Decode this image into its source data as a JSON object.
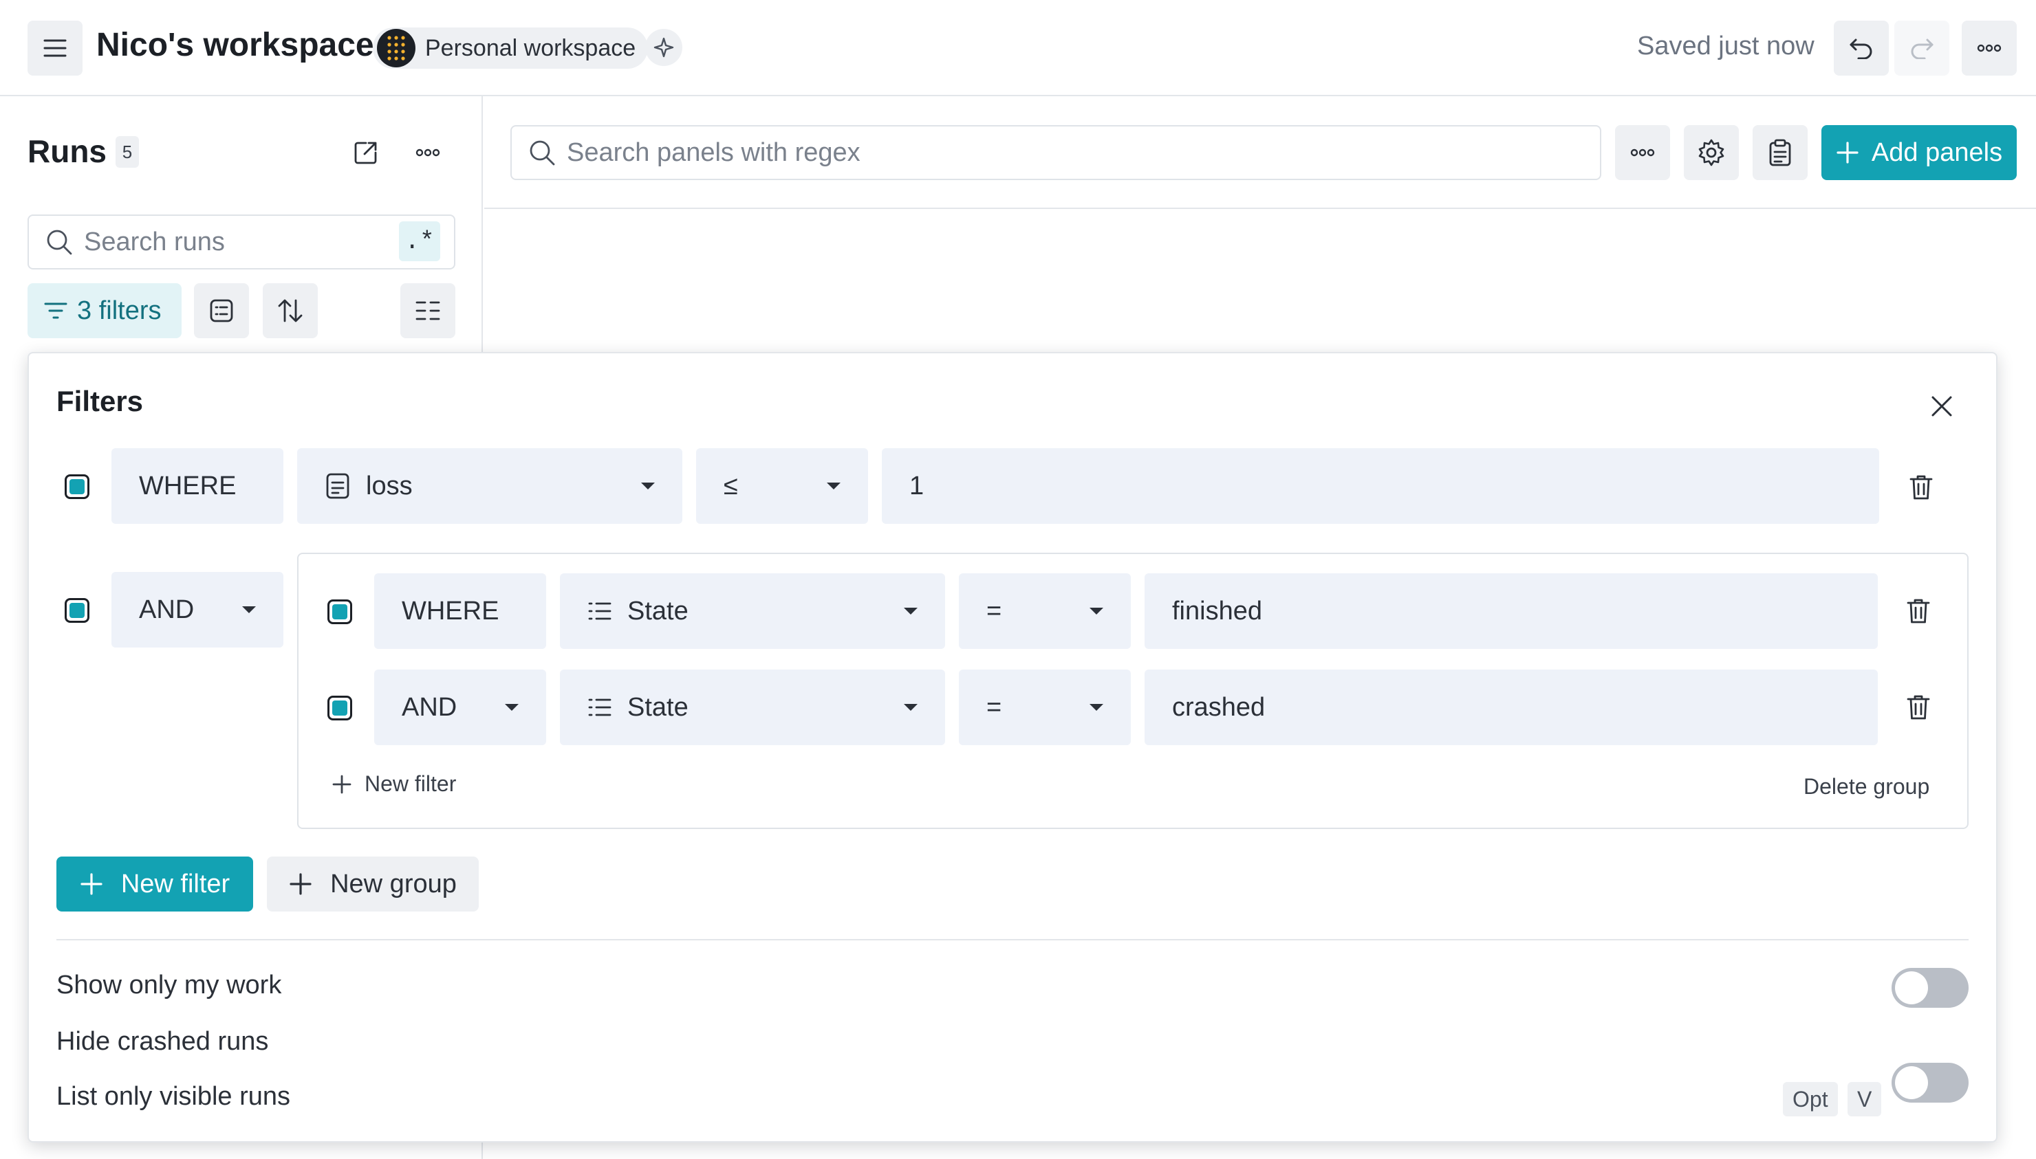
{
  "header": {
    "title": "Nico's workspace",
    "badge": "Personal workspace",
    "save_status": "Saved just now"
  },
  "sidebar": {
    "title": "Runs",
    "count": "5",
    "search_placeholder": "Search runs",
    "regex_label": ".*",
    "filters_label": "3 filters"
  },
  "main": {
    "search_placeholder": "Search panels with regex",
    "add_panels_label": "Add panels"
  },
  "filters": {
    "title": "Filters",
    "rows": [
      {
        "conjunction": "WHERE",
        "field": "loss",
        "field_icon": "note-icon",
        "operator": "≤",
        "value": "1"
      }
    ],
    "group": {
      "conjunction": "AND",
      "rows": [
        {
          "conjunction": "WHERE",
          "field": "State",
          "field_icon": "list-icon",
          "operator": "=",
          "value": "finished"
        },
        {
          "conjunction": "AND",
          "field": "State",
          "field_icon": "list-icon",
          "operator": "=",
          "value": "crashed"
        }
      ],
      "new_filter_label": "New filter",
      "delete_group_label": "Delete group"
    },
    "new_filter_label": "New filter",
    "new_group_label": "New group",
    "options": [
      {
        "label": "Show only my work",
        "enabled": false
      },
      {
        "label": "Hide crashed runs",
        "enabled": false
      },
      {
        "label": "List only visible runs",
        "enabled": false,
        "shortcut": [
          "Opt",
          "V"
        ]
      }
    ]
  },
  "colors": {
    "accent": "#13a2b3",
    "accent_light": "#e2f3f6",
    "field_bg": "#eef2f9",
    "button_bg": "#eef0f3"
  }
}
